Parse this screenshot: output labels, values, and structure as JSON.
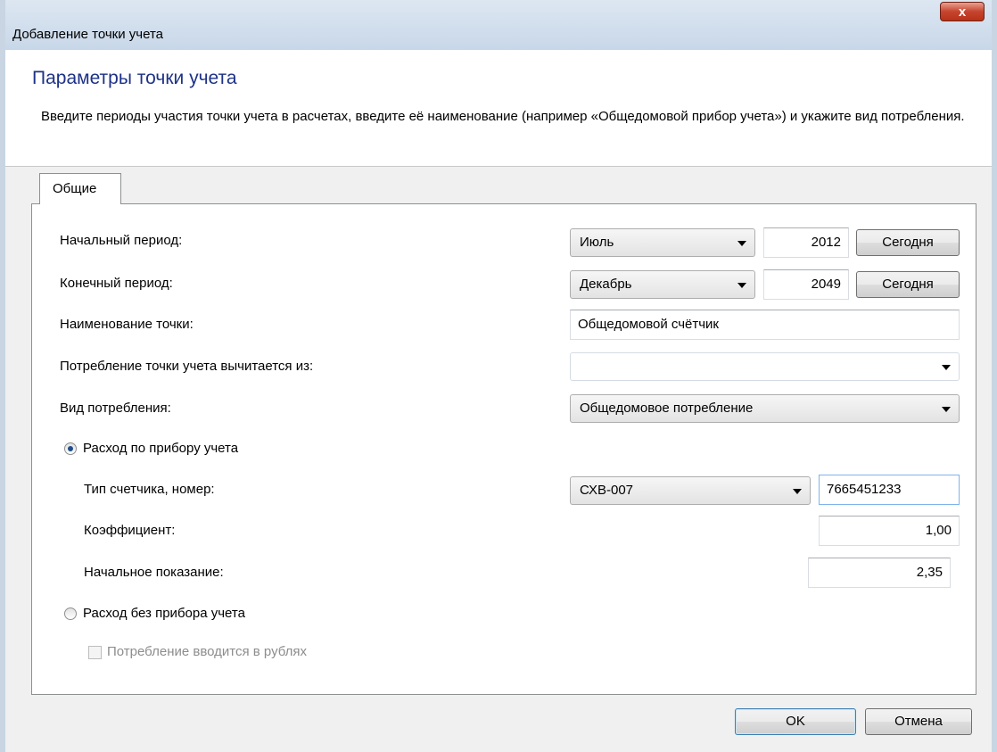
{
  "window": {
    "title": "Добавление точки учета",
    "close_label": "x"
  },
  "header": {
    "title": "Параметры точки учета",
    "description": "Введите периоды участия точки учета в расчетах, введите её наименование (например «Общедомовой прибор учета») и укажите вид потребления."
  },
  "tabs": [
    {
      "label": "Общие"
    }
  ],
  "form": {
    "start_period": {
      "label": "Начальный период:",
      "month": "Июль",
      "year": "2012",
      "today_label": "Сегодня"
    },
    "end_period": {
      "label": "Конечный период:",
      "month": "Декабрь",
      "year": "2049",
      "today_label": "Сегодня"
    },
    "point_name": {
      "label": "Наименование точки:",
      "value": "Общедомовой счётчик"
    },
    "subtracted_from": {
      "label": "Потребление точки учета вычитается из:",
      "value": ""
    },
    "consumption_type": {
      "label": "Вид потребления:",
      "value": "Общедомовое потребление"
    },
    "metered": {
      "label": "Расход по прибору учета",
      "selected": true,
      "meter_type": {
        "label": "Тип счетчика, номер:",
        "value": "СХВ-007",
        "number": "7665451233"
      },
      "coefficient": {
        "label": "Коэффициент:",
        "value": "1,00"
      },
      "initial_reading": {
        "label": "Начальное показание:",
        "value": "2,35"
      }
    },
    "unmetered": {
      "label": "Расход без прибора учета",
      "selected": false,
      "rubles_checkbox": {
        "label": "Потребление вводится в рублях",
        "checked": false
      }
    }
  },
  "footer": {
    "ok_label": "OK",
    "cancel_label": "Отмена"
  }
}
